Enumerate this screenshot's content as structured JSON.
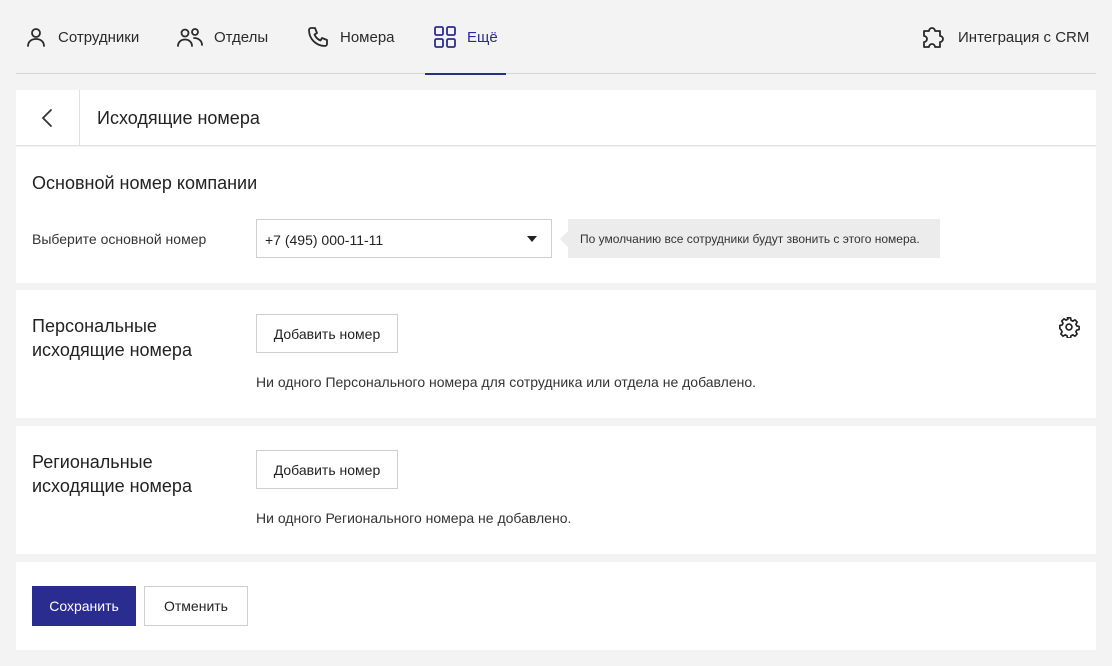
{
  "nav": {
    "items": [
      {
        "label": "Сотрудники",
        "icon": "user-icon"
      },
      {
        "label": "Отделы",
        "icon": "users-icon"
      },
      {
        "label": "Номера",
        "icon": "phone-icon"
      },
      {
        "label": "Ещё",
        "icon": "grid-icon",
        "active": true
      }
    ],
    "integration_label": "Интеграция с CRM",
    "accent": "#2b2c8f"
  },
  "header": {
    "title": "Исходящие номера"
  },
  "main_number": {
    "section_title": "Основной номер компании",
    "field_label": "Выберите основной номер",
    "selected_value": "+7 (495) 000-11-11",
    "hint": "По умолчанию все сотрудники будут звонить с этого номера."
  },
  "personal": {
    "title_line1": "Персональные",
    "title_line2": "исходящие номера",
    "add_button": "Добавить номер",
    "empty_text": "Ни одного Персонального номера для сотрудника или отдела не добавлено."
  },
  "regional": {
    "title_line1": "Региональные",
    "title_line2": "исходящие номера",
    "add_button": "Добавить номер",
    "empty_text": "Ни одного Регионального номера не добавлено."
  },
  "footer": {
    "save_label": "Сохранить",
    "cancel_label": "Отменить"
  }
}
